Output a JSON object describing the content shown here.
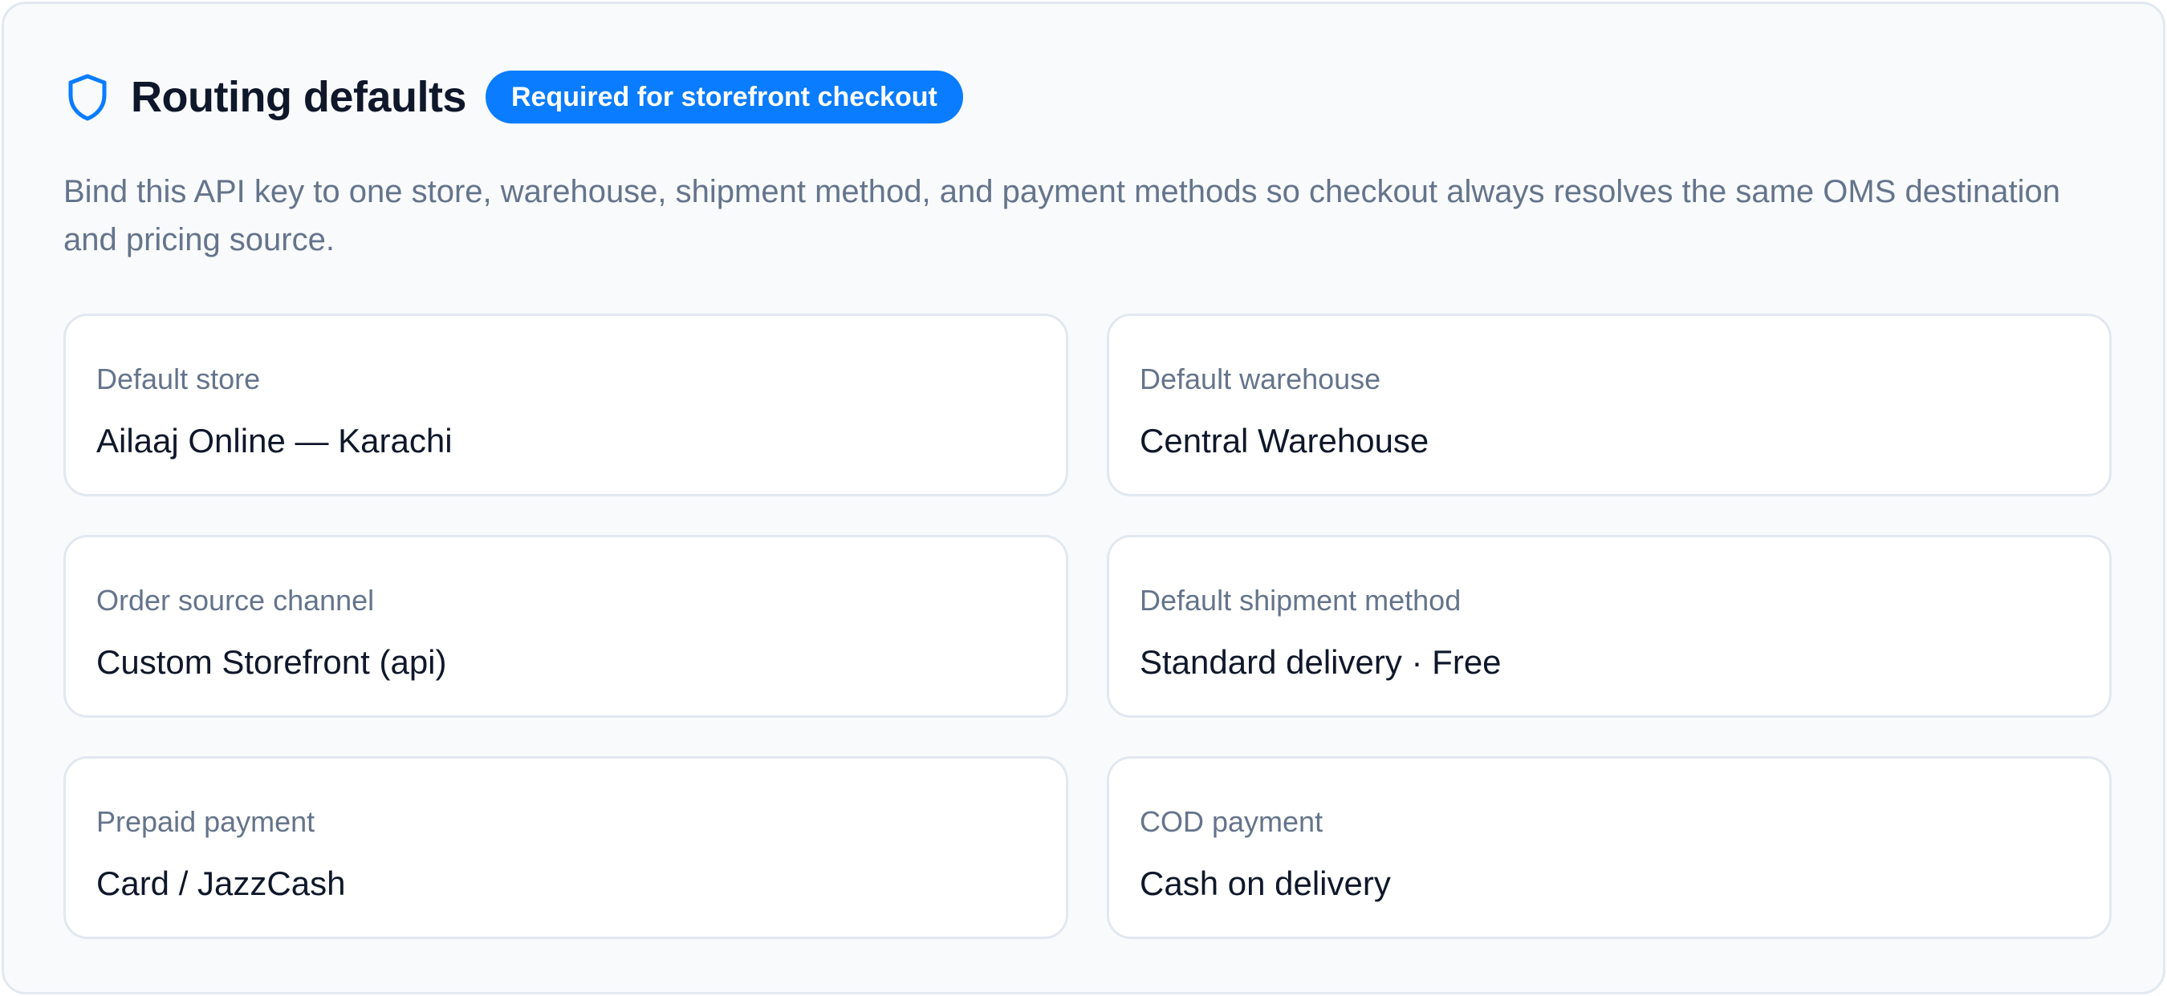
{
  "header": {
    "title": "Routing defaults",
    "badge": "Required for storefront checkout",
    "icon": "shield-icon",
    "accent_color": "#0a7cff"
  },
  "description": "Bind this API key to one store, warehouse, shipment method, and payment methods so checkout always resolves the same OMS destination and pricing source.",
  "fields": [
    {
      "label": "Default store",
      "value": "Ailaaj Online — Karachi"
    },
    {
      "label": "Default warehouse",
      "value": "Central Warehouse"
    },
    {
      "label": "Order source channel",
      "value": "Custom Storefront (api)"
    },
    {
      "label": "Default shipment method",
      "value": "Standard delivery · Free"
    },
    {
      "label": "Prepaid payment",
      "value": "Card / JazzCash"
    },
    {
      "label": "COD payment",
      "value": "Cash on delivery"
    }
  ]
}
